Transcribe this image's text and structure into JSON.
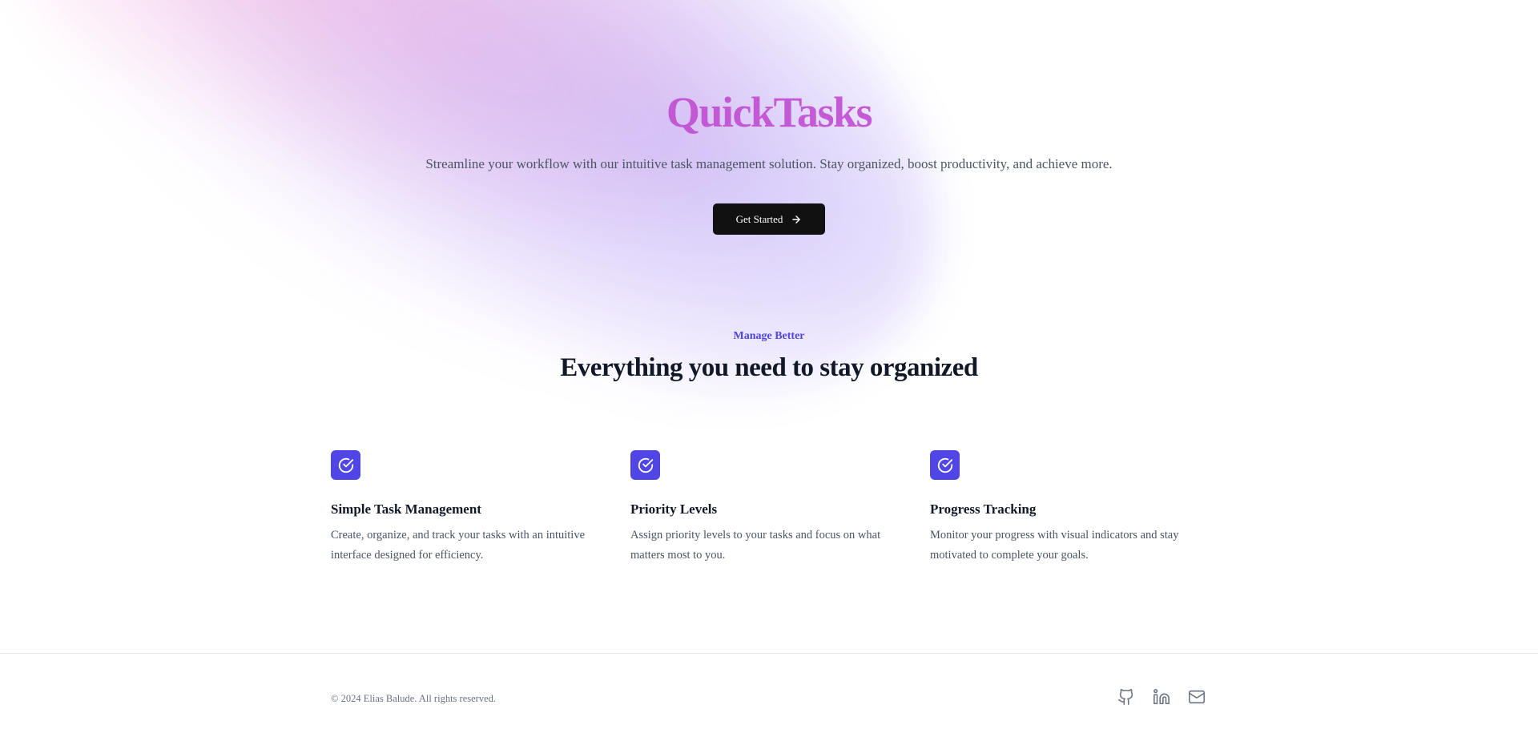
{
  "hero": {
    "title": "QuickTasks",
    "subtitle": "Streamline your workflow with our intuitive task management solution. Stay organized, boost productivity, and achieve more.",
    "cta_label": "Get Started",
    "cta_icon": "arrow-right-icon"
  },
  "features_section": {
    "eyebrow": "Manage Better",
    "title": "Everything you need to stay organized",
    "items": [
      {
        "icon": "check-circle-icon",
        "title": "Simple Task Management",
        "description": "Create, organize, and track your tasks with an intuitive interface designed for efficiency."
      },
      {
        "icon": "check-circle-icon",
        "title": "Priority Levels",
        "description": "Assign priority levels to your tasks and focus on what matters most to you."
      },
      {
        "icon": "check-circle-icon",
        "title": "Progress Tracking",
        "description": "Monitor your progress with visual indicators and stay motivated to complete your goals."
      }
    ]
  },
  "footer": {
    "copyright": "© 2024 Elias Balude. All rights reserved.",
    "social": [
      "github-icon",
      "linkedin-icon",
      "mail-icon"
    ]
  },
  "colors": {
    "accent": "#4f46e5",
    "title_gradient": "#c04fd0",
    "button_bg": "#111111",
    "muted_text": "#4b5563"
  }
}
